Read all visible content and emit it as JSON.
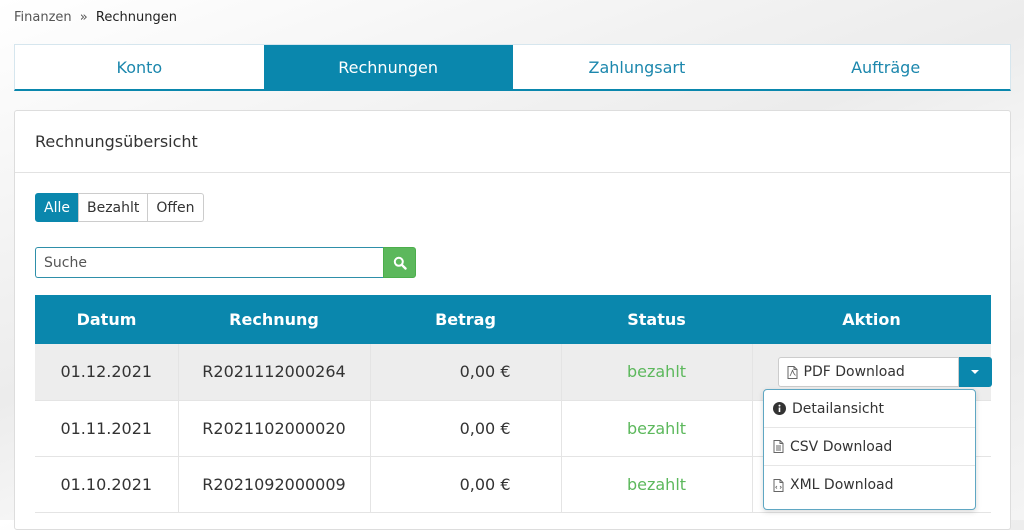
{
  "breadcrumb": {
    "parent": "Finanzen",
    "separator": "»",
    "current": "Rechnungen"
  },
  "tabs": [
    {
      "label": "Konto",
      "active": false
    },
    {
      "label": "Rechnungen",
      "active": true
    },
    {
      "label": "Zahlungsart",
      "active": false
    },
    {
      "label": "Aufträge",
      "active": false
    }
  ],
  "panel": {
    "title": "Rechnungsübersicht"
  },
  "filters": [
    {
      "label": "Alle",
      "active": true
    },
    {
      "label": "Bezahlt",
      "active": false
    },
    {
      "label": "Offen",
      "active": false
    }
  ],
  "search": {
    "placeholder": "Suche",
    "value": "",
    "icon": "search-icon"
  },
  "table": {
    "headers": [
      "Datum",
      "Rechnung",
      "Betrag",
      "Status",
      "Aktion"
    ],
    "rows": [
      {
        "date": "01.12.2021",
        "invoice": "R2021112000264",
        "amount": "0,00 €",
        "status": "bezahlt"
      },
      {
        "date": "01.11.2021",
        "invoice": "R2021102000020",
        "amount": "0,00 €",
        "status": "bezahlt"
      },
      {
        "date": "01.10.2021",
        "invoice": "R2021092000009",
        "amount": "0,00 €",
        "status": "bezahlt"
      }
    ]
  },
  "action": {
    "label": "PDF Download",
    "icon": "pdf-file-icon"
  },
  "dropdown": {
    "items": [
      {
        "label": "Detailansicht",
        "icon": "info-circle-icon"
      },
      {
        "label": "CSV Download",
        "icon": "document-icon"
      },
      {
        "label": "XML Download",
        "icon": "code-file-icon"
      }
    ]
  },
  "colors": {
    "primary": "#0a87ad",
    "success": "#5cb85c",
    "row_highlight": "#ededed"
  }
}
